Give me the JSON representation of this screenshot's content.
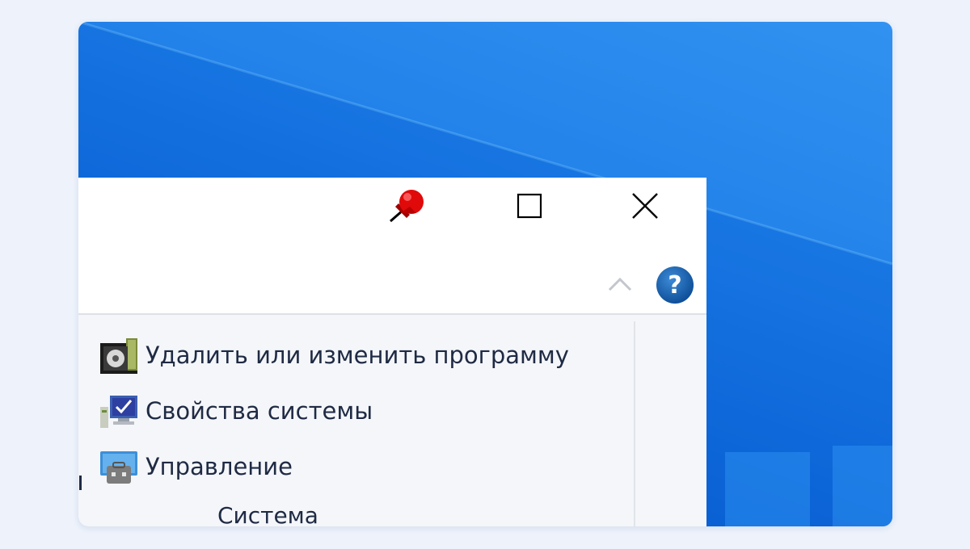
{
  "window": {
    "title_bar": {
      "pin_icon": "red-pushpin-icon",
      "maximize_icon": "maximize-icon",
      "close_icon": "close-icon"
    },
    "ribbon": {
      "collapse_icon": "chevron-up-icon",
      "help_icon": "help-icon"
    }
  },
  "items": [
    {
      "label": "Удалить или изменить программу",
      "icon": "uninstall-program-icon"
    },
    {
      "label": "Свойства системы",
      "icon": "system-properties-icon"
    },
    {
      "label": "Управление",
      "icon": "computer-management-icon"
    }
  ],
  "section_label": "Система",
  "colors": {
    "desktop_blue": "#1a7ae6",
    "help_blue": "#1a64b4",
    "pin_red": "#e00a0a",
    "text": "#1f2a44"
  }
}
